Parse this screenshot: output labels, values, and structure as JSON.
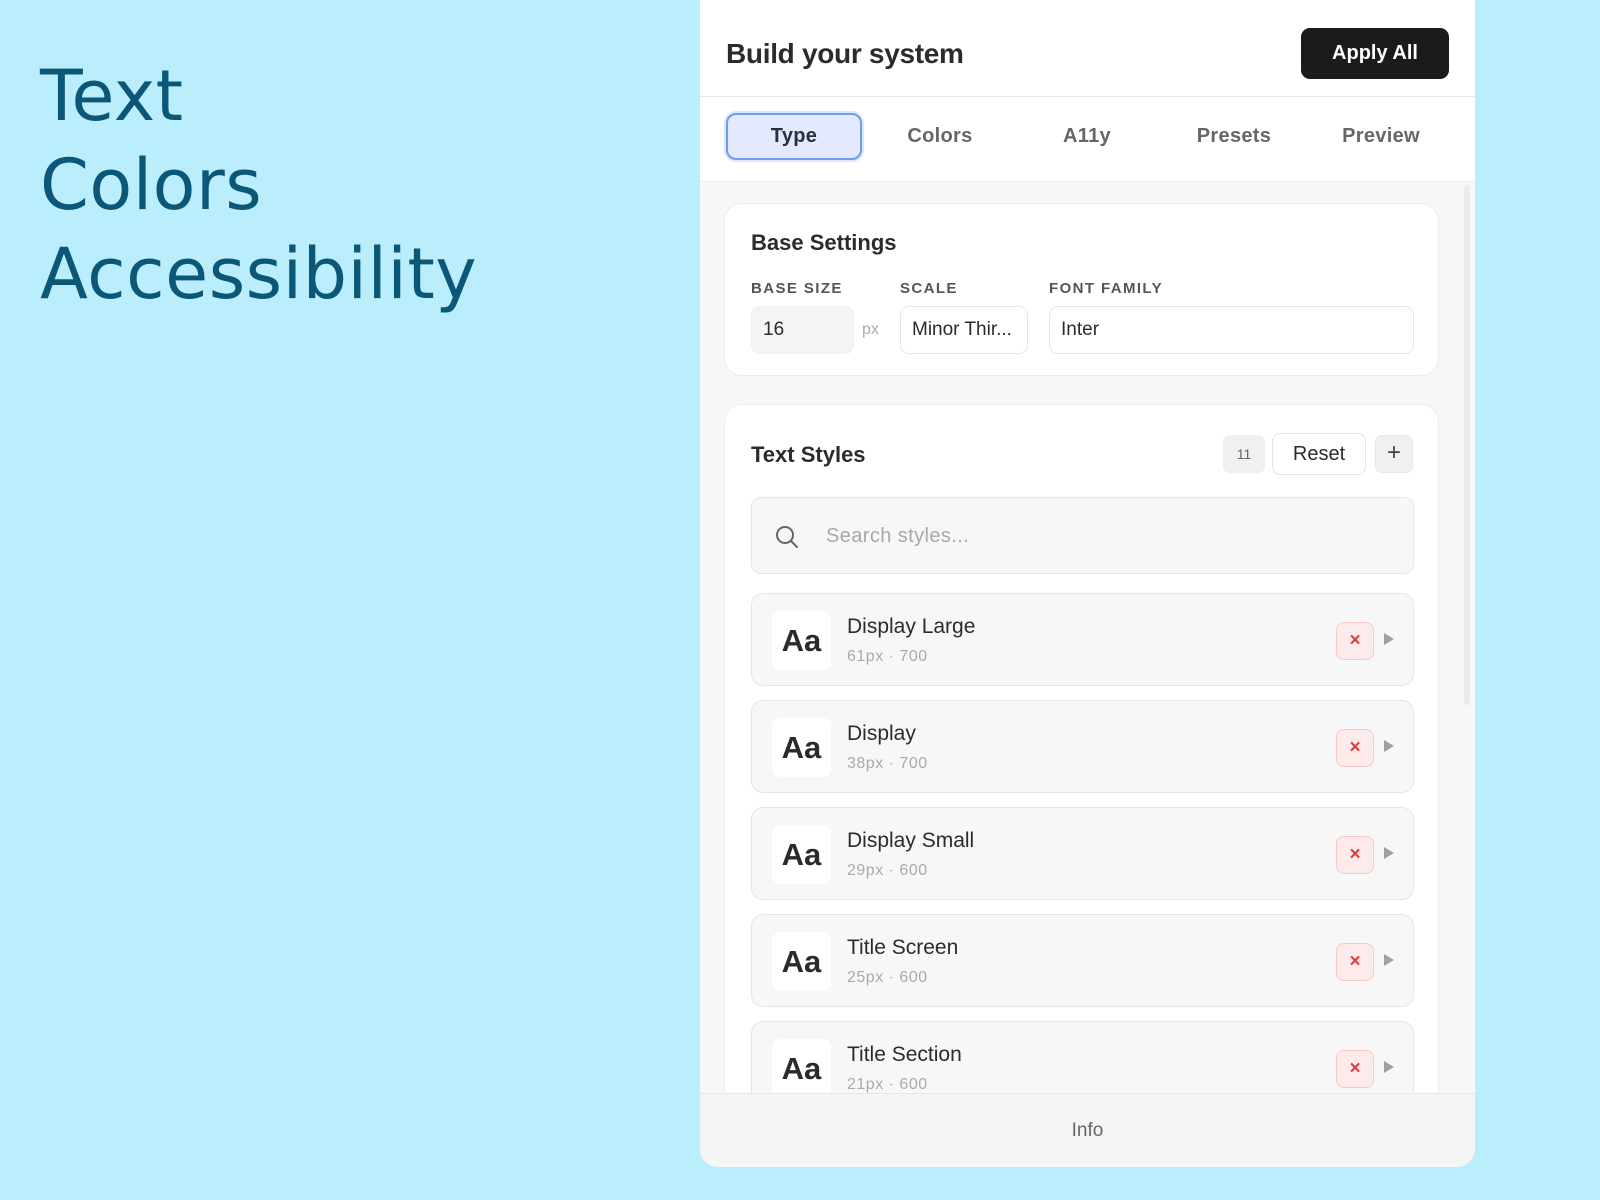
{
  "hero": {
    "lines": [
      "Text",
      "Colors",
      "Accessibility"
    ]
  },
  "header": {
    "title": "Build your system",
    "apply_label": "Apply All"
  },
  "tabs": [
    {
      "label": "Type",
      "active": true
    },
    {
      "label": "Colors",
      "active": false
    },
    {
      "label": "A11y",
      "active": false
    },
    {
      "label": "Presets",
      "active": false
    },
    {
      "label": "Preview",
      "active": false
    }
  ],
  "base_settings": {
    "title": "Base Settings",
    "base_size_label": "BASE SIZE",
    "base_size_value": "16",
    "unit": "px",
    "scale_label": "SCALE",
    "scale_value": "Minor Thir...",
    "font_family_label": "FONT FAMILY",
    "font_family_value": "Inter"
  },
  "text_styles": {
    "title": "Text Styles",
    "count": "11",
    "reset_label": "Reset",
    "add_label": "+",
    "search_placeholder": "Search styles...",
    "items": [
      {
        "preview": "Aa",
        "name": "Display Large",
        "meta": "61px · 700"
      },
      {
        "preview": "Aa",
        "name": "Display",
        "meta": "38px · 700"
      },
      {
        "preview": "Aa",
        "name": "Display Small",
        "meta": "29px · 600"
      },
      {
        "preview": "Aa",
        "name": "Title Screen",
        "meta": "25px · 600"
      },
      {
        "preview": "Aa",
        "name": "Title Section",
        "meta": "21px · 600"
      }
    ],
    "delete_label": "×"
  },
  "footer": {
    "label": "Info"
  },
  "colors": {
    "background": "#baeefd",
    "hero_text": "#0b5777",
    "accent": "#6d9cf0",
    "danger": "#e03b3b"
  }
}
